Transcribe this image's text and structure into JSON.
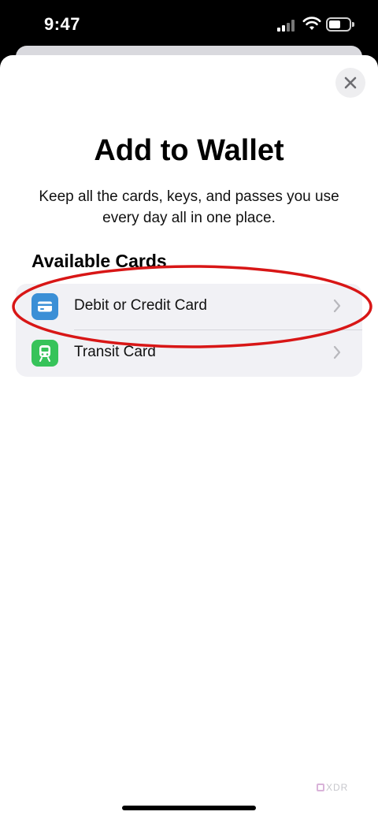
{
  "status_bar": {
    "time": "9:47",
    "icons": [
      "cellular-signal-icon",
      "wifi-icon",
      "battery-icon"
    ]
  },
  "sheet": {
    "close_icon": "close-icon",
    "title": "Add to Wallet",
    "subtitle": "Keep all the cards, keys, and passes you use every day all in one place."
  },
  "available_cards": {
    "header": "Available Cards",
    "items": [
      {
        "label": "Debit or Credit Card",
        "icon": "credit-card-icon",
        "icon_color": "#3b8fd6"
      },
      {
        "label": "Transit Card",
        "icon": "train-icon",
        "icon_color": "#37c35a"
      }
    ]
  },
  "annotation": {
    "color": "#d81616"
  },
  "watermark": {
    "text": "XDR"
  }
}
